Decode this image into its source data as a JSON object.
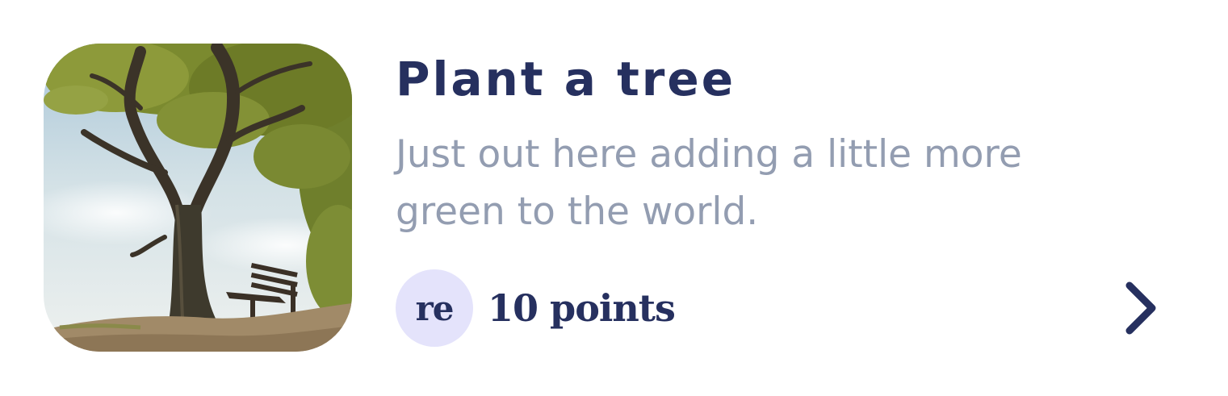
{
  "card": {
    "title": "Plant a tree",
    "description": "Just out here adding a little more green to the world.",
    "image_subject": "tree-with-bench",
    "reward": {
      "badge": "re",
      "points_label": "10 points"
    },
    "icons": {
      "arrow": "chevron-right-icon"
    },
    "colors": {
      "title": "#26305f",
      "description": "#939db1",
      "badge_bg": "#e4e3fb",
      "accent": "#26305f"
    }
  }
}
